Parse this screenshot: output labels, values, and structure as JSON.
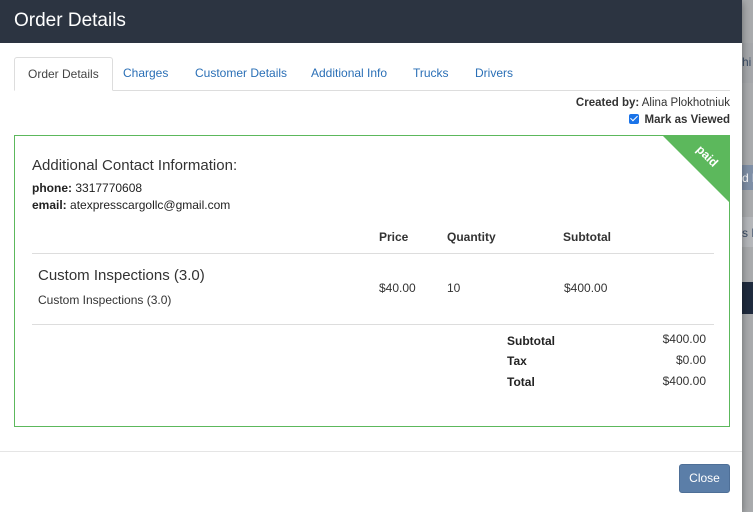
{
  "background": {
    "fragments": [
      "hi",
      "d l",
      "s N"
    ]
  },
  "modal": {
    "title": "Order Details",
    "tabs": [
      {
        "label": "Order Details",
        "active": true
      },
      {
        "label": "Charges",
        "active": false
      },
      {
        "label": "Customer Details",
        "active": false
      },
      {
        "label": "Additional Info",
        "active": false
      },
      {
        "label": "Trucks",
        "active": false
      },
      {
        "label": "Drivers",
        "active": false
      }
    ],
    "created_by_label": "Created by:",
    "created_by_value": "Alina Plokhotniuk",
    "mark_viewed_label": "Mark as Viewed",
    "mark_viewed_checked": true
  },
  "order": {
    "status_ribbon": "paid",
    "contact": {
      "title": "Additional Contact Information:",
      "phone_label": "phone:",
      "phone_value": "3317770608",
      "email_label": "email:",
      "email_value": "atexpresscargollc@gmail.com"
    },
    "columns": {
      "price": "Price",
      "quantity": "Quantity",
      "subtotal": "Subtotal"
    },
    "items": [
      {
        "name": "Custom Inspections (3.0)",
        "description": "Custom Inspections (3.0)",
        "price": "$40.00",
        "quantity": "10",
        "subtotal": "$400.00"
      }
    ],
    "summary": {
      "subtotal_label": "Subtotal",
      "subtotal_value": "$400.00",
      "tax_label": "Tax",
      "tax_value": "$0.00",
      "total_label": "Total",
      "total_value": "$400.00"
    }
  },
  "footer": {
    "close_label": "Close"
  },
  "colors": {
    "header_bg": "#2c3441",
    "accent_link": "#2a6fb6",
    "paid_green": "#5cb85c",
    "close_button": "#5b7ea8"
  }
}
